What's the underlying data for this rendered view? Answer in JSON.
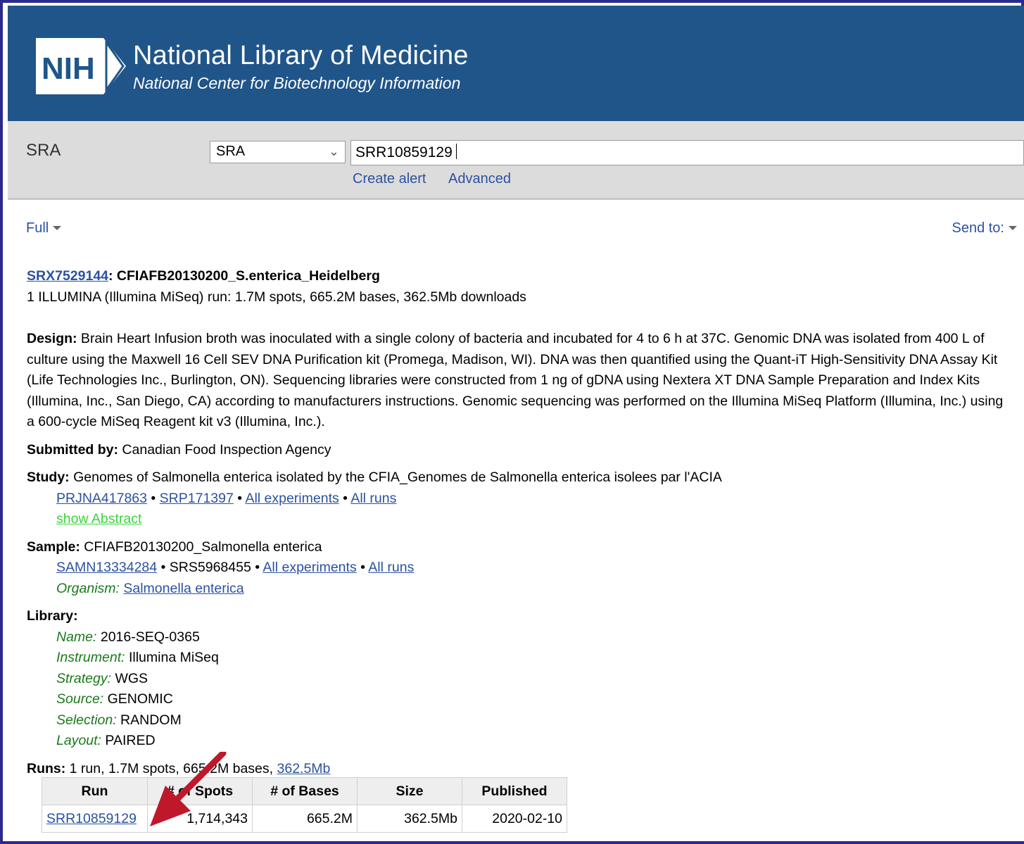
{
  "header": {
    "logo_text": "NIH",
    "title": "National Library of Medicine",
    "subtitle": "National Center for Biotechnology Information"
  },
  "search": {
    "db_label": "SRA",
    "db_selected": "SRA",
    "query": "SRR10859129",
    "create_alert": "Create alert",
    "advanced": "Advanced"
  },
  "toolbar": {
    "format": "Full",
    "send_to": "Send to:"
  },
  "record": {
    "accession": "SRX7529144",
    "title_rest": ": CFIAFB20130200_S.enterica_Heidelberg",
    "summary": "1 ILLUMINA (Illumina MiSeq) run: 1.7M spots, 665.2M bases, 362.5Mb downloads",
    "design_label": "Design:",
    "design_text": " Brain Heart Infusion broth was inoculated with a single colony of bacteria and incubated for 4 to 6 h at 37C. Genomic DNA was isolated from 400 L of culture using the Maxwell 16 Cell SEV DNA Purification kit (Promega, Madison, WI). DNA was then quantified using the Quant-iT High-Sensitivity DNA Assay Kit (Life Technologies Inc., Burlington, ON). Sequencing libraries were constructed from 1 ng of gDNA using Nextera XT DNA Sample Preparation and Index Kits (Illumina, Inc., San Diego, CA) according to manufacturers instructions. Genomic sequencing was performed on the Illumina MiSeq Platform (Illumina, Inc.) using a 600-cycle MiSeq Reagent kit v3 (Illumina, Inc.).",
    "submitted_label": "Submitted by:",
    "submitted_text": " Canadian Food Inspection Agency",
    "study_label": "Study:",
    "study_text": " Genomes of Salmonella enterica isolated by the CFIA_Genomes de Salmonella enterica isolees par l'ACIA",
    "study_links": {
      "bioproject": "PRJNA417863",
      "srp": "SRP171397",
      "all_experiments": "All experiments",
      "all_runs": "All runs",
      "sep": " • "
    },
    "show_abstract": "show Abstract",
    "sample_label": "Sample:",
    "sample_text": " CFIAFB20130200_Salmonella enterica",
    "sample_links": {
      "biosample": "SAMN13334284",
      "srs": "SRS5968455",
      "all_experiments": "All experiments",
      "all_runs": "All runs",
      "sep": " • "
    },
    "organism_label": "Organism:",
    "organism": "Salmonella enterica",
    "library_label": "Library:",
    "library": [
      {
        "k": "Name:",
        "v": " 2016-SEQ-0365"
      },
      {
        "k": "Instrument:",
        "v": " Illumina MiSeq"
      },
      {
        "k": "Strategy:",
        "v": " WGS"
      },
      {
        "k": "Source:",
        "v": " GENOMIC"
      },
      {
        "k": "Selection:",
        "v": " RANDOM"
      },
      {
        "k": "Layout:",
        "v": " PAIRED"
      }
    ],
    "runs_label": "Runs:",
    "runs_text": " 1 run, 1.7M spots, 665.2M bases, ",
    "runs_size_link": "362.5Mb"
  },
  "runs_table": {
    "headers": [
      "Run",
      "# of Spots",
      "# of Bases",
      "Size",
      "Published"
    ],
    "rows": [
      [
        "SRR10859129",
        "1,714,343",
        "665.2M",
        "362.5Mb",
        "2020-02-10"
      ]
    ]
  },
  "colors": {
    "banner": "#20558a",
    "link": "#2b52a0",
    "label_green": "#1a7a1a",
    "abstract_green": "#3bd43b",
    "arrow": "#c0182b",
    "frame": "#2b2a8c"
  }
}
